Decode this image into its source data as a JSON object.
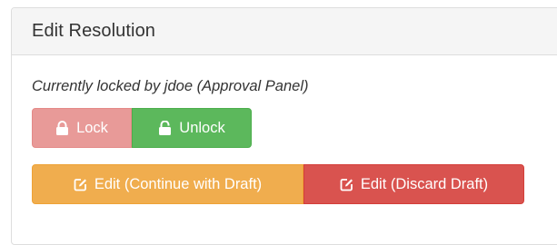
{
  "panel": {
    "title": "Edit Resolution",
    "lock_status": "Currently locked by jdoe (Approval Panel)"
  },
  "lock_buttons": {
    "lock_label": "Lock",
    "lock_icon": "lock-icon",
    "unlock_label": "Unlock",
    "unlock_icon": "unlock-icon"
  },
  "edit_buttons": {
    "continue_label": "Edit (Continue with Draft)",
    "continue_icon": "edit-icon",
    "discard_label": "Edit (Discard Draft)",
    "discard_icon": "edit-icon"
  },
  "colors": {
    "lock": "#e89a98",
    "unlock": "#5cb85c",
    "continue": "#f0ad4e",
    "discard": "#d9534f"
  }
}
